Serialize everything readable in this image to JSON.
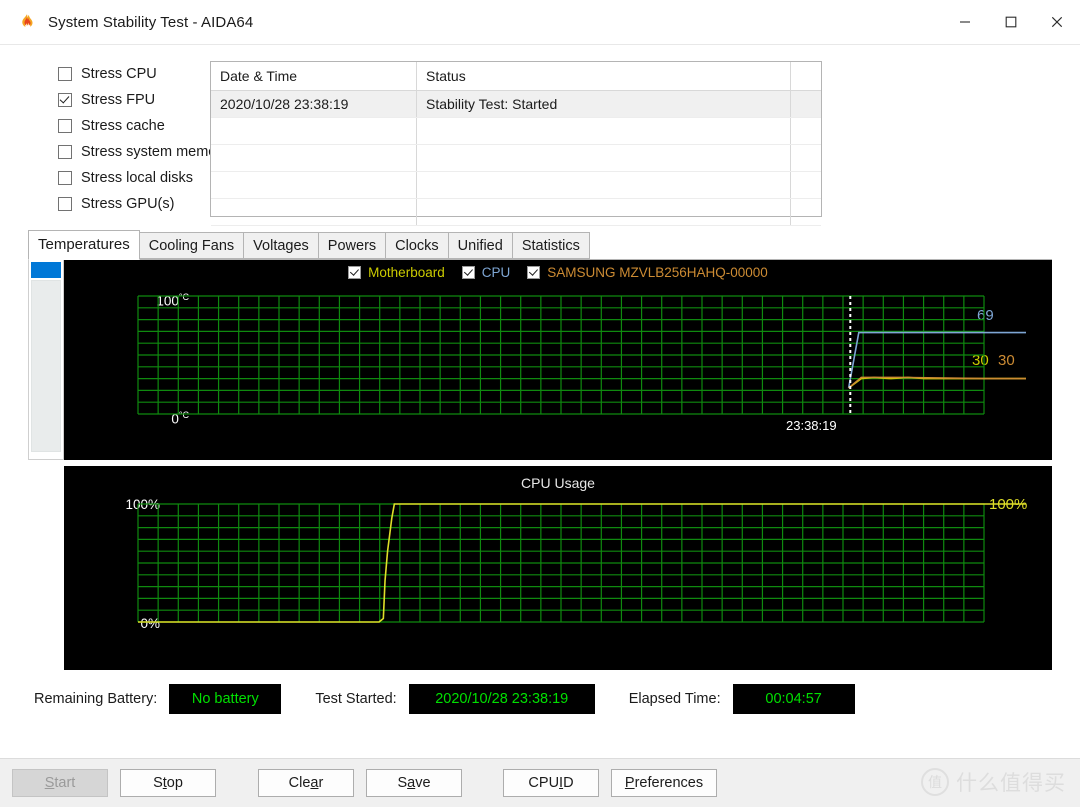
{
  "window": {
    "title": "System Stability Test - AIDA64",
    "icon": "flame-icon",
    "minimize_label": "–",
    "maximize_label": "☐",
    "close_label": "✕"
  },
  "stress_options": [
    {
      "label": "Stress CPU",
      "checked": false
    },
    {
      "label": "Stress FPU",
      "checked": true
    },
    {
      "label": "Stress cache",
      "checked": false
    },
    {
      "label": "Stress system memory",
      "checked": false
    },
    {
      "label": "Stress local disks",
      "checked": false
    },
    {
      "label": "Stress GPU(s)",
      "checked": false
    }
  ],
  "status_grid": {
    "columns": [
      "Date & Time",
      "Status",
      ""
    ],
    "rows": [
      {
        "datetime": "2020/10/28 23:38:19",
        "status": "Stability Test: Started",
        "extra": ""
      }
    ],
    "empty_row_count": 4
  },
  "tabs": [
    {
      "label": "Temperatures",
      "active": true
    },
    {
      "label": "Cooling Fans",
      "active": false
    },
    {
      "label": "Voltages",
      "active": false
    },
    {
      "label": "Powers",
      "active": false
    },
    {
      "label": "Clocks",
      "active": false
    },
    {
      "label": "Unified",
      "active": false
    },
    {
      "label": "Statistics",
      "active": false
    }
  ],
  "chart_data": [
    {
      "type": "line",
      "name": "temperatures",
      "title": "",
      "ylabel_top": "100",
      "ylabel_top_unit": "°C",
      "ylabel_bottom": "0",
      "ylabel_bottom_unit": "°C",
      "ylim": [
        0,
        100
      ],
      "grid": true,
      "grid_color": "#0f8a0f",
      "background": "#000000",
      "xtick_label": "23:38:19",
      "marker_line": "dashed-white-vertical",
      "legend_position": "top-center",
      "series": [
        {
          "name": "Motherboard",
          "color": "#cccc00",
          "current_value": 30,
          "value_label": "30",
          "points": [
            [
              0.84,
              22
            ],
            [
              0.855,
              30
            ],
            [
              0.87,
              31
            ],
            [
              0.89,
              30
            ],
            [
              0.91,
              31
            ],
            [
              0.93,
              30
            ],
            [
              0.95,
              30
            ],
            [
              1.0,
              30
            ]
          ]
        },
        {
          "name": "CPU",
          "color": "#7ea6d4",
          "current_value": 69,
          "value_label": "69",
          "points": [
            [
              0.84,
              22
            ],
            [
              0.852,
              69
            ],
            [
              1.0,
              69
            ]
          ]
        },
        {
          "name": "SAMSUNG MZVLB256HAHQ-00000",
          "color": "#cc8b33",
          "current_value": 30,
          "value_label": "30",
          "points": [
            [
              0.84,
              22
            ],
            [
              0.855,
              31
            ],
            [
              0.9,
              31
            ],
            [
              1.0,
              30
            ]
          ]
        }
      ]
    },
    {
      "type": "line",
      "name": "cpu-usage",
      "title": "CPU Usage",
      "ylabel_top": "100%",
      "ylabel_bottom": "0%",
      "ylim": [
        0,
        100
      ],
      "grid": true,
      "grid_color": "#0f8a0f",
      "background": "#000000",
      "legend_position": "none",
      "series": [
        {
          "name": "CPU Usage",
          "color": "#dede28",
          "current_value": 100,
          "value_label": "100%",
          "points": [
            [
              0.0,
              0
            ],
            [
              0.285,
              0
            ],
            [
              0.29,
              3
            ],
            [
              0.292,
              35
            ],
            [
              0.295,
              60
            ],
            [
              0.3,
              88
            ],
            [
              0.303,
              100
            ],
            [
              1.0,
              100
            ]
          ]
        }
      ]
    }
  ],
  "legend": {
    "items": [
      {
        "label": "Motherboard",
        "color": "#cccc00",
        "checked": true
      },
      {
        "label": "CPU",
        "color": "#7ea6d4",
        "checked": true
      },
      {
        "label": "SAMSUNG MZVLB256HAHQ-00000",
        "color": "#cc8b33",
        "checked": true
      }
    ]
  },
  "status_bar": {
    "battery_label": "Remaining Battery:",
    "battery_value": "No battery",
    "started_label": "Test Started:",
    "started_value": "2020/10/28 23:38:19",
    "elapsed_label": "Elapsed Time:",
    "elapsed_value": "00:04:57",
    "value_color": "#00e000"
  },
  "buttons": [
    {
      "label": "Start",
      "accel": 0,
      "disabled": true,
      "style": "disabled"
    },
    {
      "label": "Stop",
      "accel": 1,
      "disabled": false,
      "style": "flat"
    },
    {
      "label": "Clear",
      "accel": 3,
      "disabled": false,
      "style": "flat"
    },
    {
      "label": "Save",
      "accel": 1,
      "disabled": false,
      "style": "flat"
    },
    {
      "label": "CPUID",
      "accel": 3,
      "disabled": false,
      "style": "flat"
    },
    {
      "label": "Preferences",
      "accel": 0,
      "disabled": false,
      "style": "flat"
    }
  ],
  "watermark": {
    "logo": "值",
    "text": "什么值得买"
  }
}
